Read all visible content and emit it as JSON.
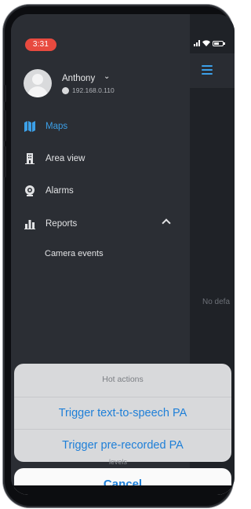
{
  "status_bar": {
    "time": "3:31"
  },
  "user": {
    "name": "Anthony",
    "ip": "192.168.0.110"
  },
  "nav": {
    "items": [
      {
        "label": "Maps",
        "icon": "map-icon",
        "active": true
      },
      {
        "label": "Area view",
        "icon": "building-icon",
        "active": false
      },
      {
        "label": "Alarms",
        "icon": "alarm-icon",
        "active": false
      },
      {
        "label": "Reports",
        "icon": "bar-chart-icon",
        "active": false,
        "expanded": true
      }
    ],
    "report_subitems": [
      "Camera events"
    ]
  },
  "background": {
    "partial_text": "No defa",
    "behind_text": "levels"
  },
  "action_sheet": {
    "title": "Hot actions",
    "actions": [
      "Trigger text-to-speech PA",
      "Trigger pre-recorded PA"
    ],
    "cancel": "Cancel"
  },
  "colors": {
    "accent": "#3ca0e8",
    "drawer_bg": "#2b2e34",
    "time_pill": "#e84a3f",
    "sheet_text": "#1e7fd8"
  }
}
